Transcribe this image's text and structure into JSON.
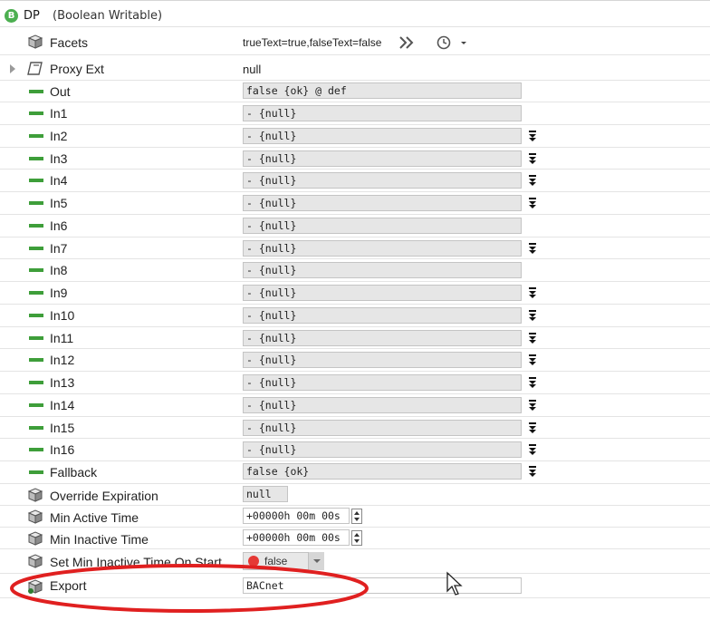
{
  "header": {
    "badge": "B",
    "name": "DP",
    "type": "(Boolean Writable)"
  },
  "facets": {
    "label": "Facets",
    "value": "trueText=true,falseText=false"
  },
  "proxy_ext": {
    "label": "Proxy Ext",
    "value": "null"
  },
  "out": {
    "label": "Out",
    "value": "false {ok} @ def"
  },
  "inputs": [
    {
      "label": "In1",
      "value": "- {null}"
    },
    {
      "label": "In2",
      "value": "- {null}"
    },
    {
      "label": "In3",
      "value": "- {null}"
    },
    {
      "label": "In4",
      "value": "- {null}"
    },
    {
      "label": "In5",
      "value": "- {null}"
    },
    {
      "label": "In6",
      "value": "- {null}"
    },
    {
      "label": "In7",
      "value": "- {null}"
    },
    {
      "label": "In8",
      "value": "- {null}"
    },
    {
      "label": "In9",
      "value": "- {null}"
    },
    {
      "label": "In10",
      "value": "- {null}"
    },
    {
      "label": "In11",
      "value": "- {null}"
    },
    {
      "label": "In12",
      "value": "- {null}"
    },
    {
      "label": "In13",
      "value": "- {null}"
    },
    {
      "label": "In14",
      "value": "- {null}"
    },
    {
      "label": "In15",
      "value": "- {null}"
    },
    {
      "label": "In16",
      "value": "- {null}"
    }
  ],
  "fallback": {
    "label": "Fallback",
    "value": "false {ok}"
  },
  "override_expiration": {
    "label": "Override Expiration",
    "value": "null"
  },
  "min_active_time": {
    "label": "Min Active Time",
    "value": "+00000h 00m 00s"
  },
  "min_inactive_time": {
    "label": "Min Inactive Time",
    "value": "+00000h 00m 00s"
  },
  "set_min_inactive": {
    "label": "Set Min Inactive Time On Start",
    "value": "false"
  },
  "export": {
    "label": "Export",
    "value": "BACnet"
  },
  "colors": {
    "accent_green": "#3e9e3a",
    "badge_green": "#4caf50",
    "annotation_red": "#e02020"
  }
}
